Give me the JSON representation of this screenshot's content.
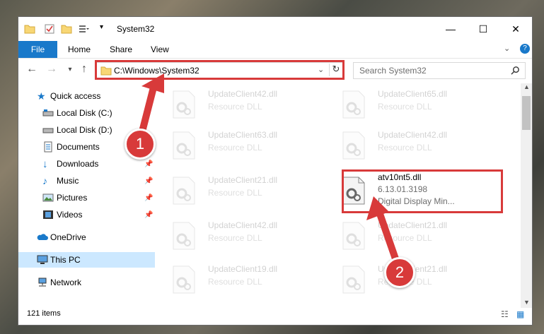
{
  "window": {
    "title": "System32",
    "controls": {
      "minimize": "—",
      "maximize": "☐",
      "close": "✕"
    }
  },
  "ribbon": {
    "tabs": [
      "File",
      "Home",
      "Share",
      "View"
    ],
    "help": "?"
  },
  "address": {
    "path": "C:\\Windows\\System32",
    "search_placeholder": "Search System32"
  },
  "nav": {
    "items": [
      {
        "label": "Quick access",
        "icon": "star-icon"
      },
      {
        "label": "Local Disk (C:)",
        "icon": "drive-icon"
      },
      {
        "label": "Local Disk (D:)",
        "icon": "drive-icon"
      },
      {
        "label": "Documents",
        "icon": "documents-icon"
      },
      {
        "label": "Downloads",
        "icon": "download-icon"
      },
      {
        "label": "Music",
        "icon": "music-icon"
      },
      {
        "label": "Pictures",
        "icon": "pictures-icon"
      },
      {
        "label": "Videos",
        "icon": "videos-icon"
      },
      {
        "label": "OneDrive",
        "icon": "cloud-icon"
      },
      {
        "label": "This PC",
        "icon": "computer-icon"
      },
      {
        "label": "Network",
        "icon": "network-icon"
      }
    ]
  },
  "files": [
    {
      "name": "UpdateClient42.dll",
      "desc": "Resource DLL"
    },
    {
      "name": "UpdateClient65.dll",
      "desc": "Resource DLL"
    },
    {
      "name": "UpdateClient63.dll",
      "desc": "Resource DLL"
    },
    {
      "name": "UpdateClient42.dll",
      "desc": "Resource DLL"
    },
    {
      "name": "UpdateClient21.dll",
      "desc": "Resource DLL"
    },
    {
      "name": "atv10nt5.dll",
      "version": "6.13.01.3198",
      "desc": "Digital Display Min..."
    },
    {
      "name": "UpdateClient42.dll",
      "desc": "Resource DLL"
    },
    {
      "name": "UpdateClient21.dll",
      "desc": "Resource DLL"
    },
    {
      "name": "UpdateClient19.dll",
      "desc": "Resource DLL"
    },
    {
      "name": "UpdateClient21.dll",
      "desc": "Resource DLL"
    }
  ],
  "status": {
    "count": "121 items"
  },
  "annotations": {
    "step1": "1",
    "step2": "2"
  },
  "colors": {
    "accent": "#1979ca",
    "annotation": "#d83a3a",
    "selected": "#cce8ff"
  }
}
